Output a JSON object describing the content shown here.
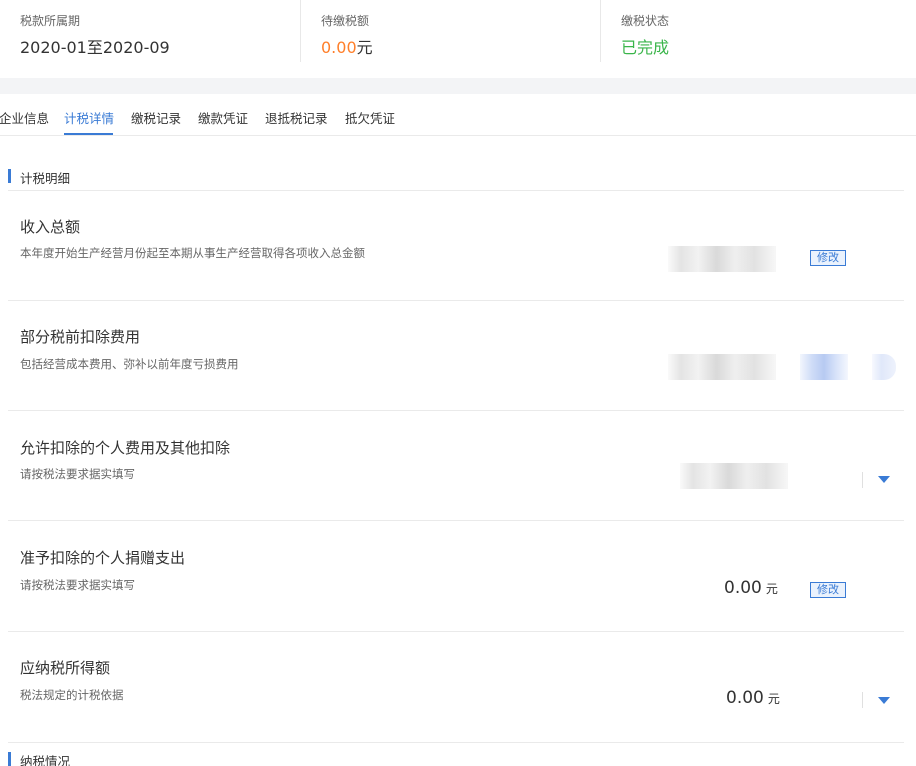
{
  "summary": {
    "period": {
      "label": "税款所属期",
      "value": "2020-01至2020-09"
    },
    "pending": {
      "label": "待缴税额",
      "amount": "0.00",
      "unit": "元"
    },
    "status": {
      "label": "缴税状态",
      "value": "已完成"
    }
  },
  "tabs": [
    {
      "label": "企业信息"
    },
    {
      "label": "计税详情",
      "active": true
    },
    {
      "label": "缴税记录"
    },
    {
      "label": "缴款凭证"
    },
    {
      "label": "退抵税记录"
    },
    {
      "label": "抵欠凭证"
    }
  ],
  "section1": {
    "title": "计税明细"
  },
  "rows": [
    {
      "title": "收入总额",
      "desc": "本年度开始生产经营月份起至本期从事生产经营取得各项收入总金额",
      "edit_label": "修改"
    },
    {
      "title": "部分税前扣除费用",
      "desc": "包括经营成本费用、弥补以前年度亏损费用"
    },
    {
      "title": "允许扣除的个人费用及其他扣除",
      "desc": "请按税法要求据实填写"
    },
    {
      "title": "准予扣除的个人捐赠支出",
      "desc": "请按税法要求据实填写",
      "amount": "0.00",
      "unit": "元",
      "edit_label": "修改"
    },
    {
      "title": "应纳税所得额",
      "desc": "税法规定的计税依据",
      "amount": "0.00",
      "unit": "元"
    }
  ],
  "section2": {
    "title": "纳税情况"
  },
  "colors": {
    "accent": "#3a7bd5",
    "orange": "#ff7f2a",
    "green": "#3ab54a"
  }
}
